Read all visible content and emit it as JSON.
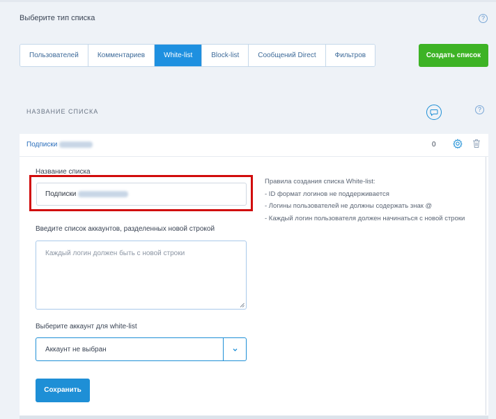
{
  "header": {
    "title": "Выберите тип списка",
    "help_symbol": "?"
  },
  "tabs": [
    {
      "label": "Пользователей",
      "active": false
    },
    {
      "label": "Комментариев",
      "active": false
    },
    {
      "label": "White-list",
      "active": true
    },
    {
      "label": "Block-list",
      "active": false
    },
    {
      "label": "Сообщений Direct",
      "active": false
    },
    {
      "label": "Фильтров",
      "active": false
    }
  ],
  "create_button": "Создать список",
  "list_section": {
    "header": "НАЗВАНИЕ СПИСКА",
    "help_symbol": "?"
  },
  "list_item": {
    "name": "Подписки",
    "count": "0"
  },
  "form": {
    "name_label": "Название списка",
    "name_value": "Подписки",
    "accounts_label": "Введите список аккаунтов, разделенных новой строкой",
    "accounts_placeholder": "Каждый логин должен быть с новой строки",
    "account_select_label": "Выберите аккаунт для white-list",
    "account_select_value": "Аккаунт не выбран",
    "save_button": "Сохранить"
  },
  "rules": {
    "title": "Правила создания списка White-list:",
    "items": [
      "- ID формат логинов не поддерживается",
      "- Логины пользователей не должны содержать знак @",
      "- Каждый логин пользователя должен начинаться с новой строки"
    ]
  },
  "colors": {
    "accent": "#1e90e0",
    "create_button": "#3db325",
    "highlight": "#d10c0c"
  }
}
